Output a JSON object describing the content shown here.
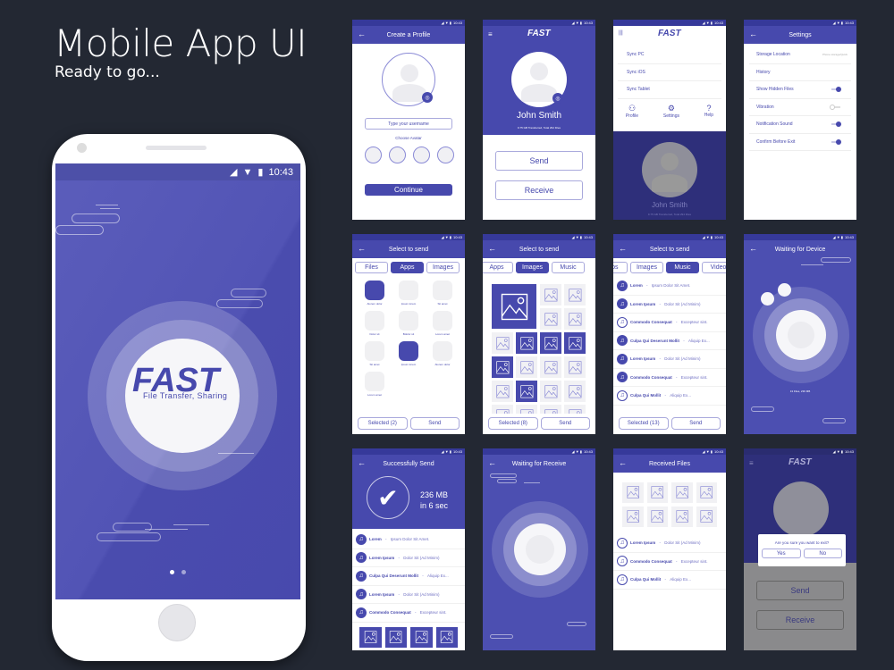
{
  "hero": {
    "title": "Mobile App UI",
    "subtitle": "Ready to go..."
  },
  "colors": {
    "background": "#232833",
    "primary": "#4749ad",
    "status_bar": "#36399a",
    "white": "#ffffff"
  },
  "status": {
    "time": "10:43",
    "icons": [
      "signal-icon",
      "wifi-icon",
      "battery-icon"
    ]
  },
  "splash": {
    "logo": "FAST",
    "tagline": "File Transfer, Sharing",
    "page_indicator": {
      "pages": 2,
      "active": 1
    }
  },
  "create_profile": {
    "title": "Create a Profile",
    "username_placeholder": "Type your username",
    "choose_avatar": "Choose Avatar",
    "continue": "Continue"
  },
  "home": {
    "logo": "FAST",
    "name": "John Smith",
    "stats": "9.75 GB Transferred, Total 294 Files",
    "send": "Send",
    "receive": "Receive"
  },
  "menu": {
    "logo": "FAST",
    "items": [
      "Sync PC",
      "Sync iOS",
      "Sync Tablet"
    ],
    "shortcuts": [
      "Profile",
      "Settings",
      "Help"
    ],
    "name": "John Smith",
    "stats": "9.75 GB Transferred, Total 294 Files"
  },
  "settings": {
    "title": "Settings",
    "rows": [
      {
        "label": "Storage Location",
        "value": "Phone storage/Quick"
      },
      {
        "label": "History"
      },
      {
        "label": "Show Hidden Files",
        "toggle": true
      },
      {
        "label": "Vibration",
        "toggle": false
      },
      {
        "label": "Notification Sound",
        "toggle": true
      },
      {
        "label": "Confirm Before Exit",
        "toggle": true
      }
    ]
  },
  "select_apps": {
    "title": "Select to send",
    "tabs": [
      "Files",
      "Apps",
      "Images"
    ],
    "active_tab": "Apps",
    "apps": [
      {
        "label": "Alorem dolor",
        "selected": true
      },
      {
        "label": "Ipsum lorem",
        "selected": false
      },
      {
        "label": "Sit amet",
        "selected": false
      },
      {
        "label": "Dolor sit",
        "selected": false
      },
      {
        "label": "Bdolor sit",
        "selected": false
      },
      {
        "label": "Lorem amet",
        "selected": false
      },
      {
        "label": "Sit amet",
        "selected": false
      },
      {
        "label": "Ipsum lorem",
        "selected": true
      },
      {
        "label": "Alorem dolor",
        "selected": false
      },
      {
        "label": "Lorem amet",
        "selected": false
      }
    ],
    "selected_btn": "Selected (2)",
    "send_btn": "Send"
  },
  "select_images": {
    "title": "Select to send",
    "tabs": [
      "Apps",
      "Images",
      "Music"
    ],
    "active_tab": "Images",
    "selected_flags": [
      false,
      false,
      false,
      false,
      false,
      true,
      true,
      true,
      true,
      false,
      false,
      false,
      false,
      true,
      false
    ],
    "selected_btn": "Selected (8)",
    "send_btn": "Send"
  },
  "select_music": {
    "title": "Select to send",
    "tabs": [
      "Apps",
      "Images",
      "Music",
      "Video"
    ],
    "active_tab": "Music",
    "songs": [
      {
        "title": "Lorem",
        "artist": "Ipsum Dolor Sit Amet.",
        "selected": true
      },
      {
        "title": "Lorem Ipsum",
        "artist": "Dolor Sit (Ad Minim)",
        "selected": true
      },
      {
        "title": "Commodo Consequat",
        "artist": "Excepteur sint.",
        "selected": false
      },
      {
        "title": "Culpa Qui  Deserunt Mollit",
        "artist": "Aliquip Ex...",
        "selected": true
      },
      {
        "title": "Lorem Ipsum",
        "artist": "Dolor Sit (Ad Minim)",
        "selected": true
      },
      {
        "title": "Commodo Consequat",
        "artist": "Excepteur sint.",
        "selected": true
      },
      {
        "title": "Culpa Qui  Mollit",
        "artist": "Aliquip Ex...",
        "selected": false
      }
    ],
    "selected_btn": "Selected (13)",
    "send_btn": "Send"
  },
  "waiting_device": {
    "title": "Waiting for Device",
    "info": "13 Files, 236 MB"
  },
  "success": {
    "title": "Successfully Send",
    "size": "236 MB",
    "time": "in 6 sec",
    "songs": [
      {
        "title": "Lorem",
        "artist": "Ipsum Dolor Sit Amet."
      },
      {
        "title": "Lorem Ipsum",
        "artist": "Dolor Sit (Ad Minim)"
      },
      {
        "title": "Culpa Qui  Deserunt Mollit",
        "artist": "Aliquip Ex..."
      },
      {
        "title": "Lorem Ipsum",
        "artist": "Dolor Sit (Ad Minim)"
      },
      {
        "title": "Commodo Consequat",
        "artist": "Excepteur sint."
      }
    ]
  },
  "waiting_receive": {
    "title": "Waiting for Receive"
  },
  "received": {
    "title": "Received Files",
    "songs": [
      {
        "title": "Lorem Ipsum",
        "artist": "Dolor Sit (Ad Minim)"
      },
      {
        "title": "Commodo Consequat",
        "artist": "Excepteur sint."
      },
      {
        "title": "Culpa Qui  Mollit",
        "artist": "Aliquip Ex..."
      }
    ]
  },
  "exit_dialog": {
    "logo": "FAST",
    "question": "Are you sure you want to exit?",
    "yes": "Yes",
    "no": "No",
    "send": "Send",
    "receive": "Receive"
  }
}
